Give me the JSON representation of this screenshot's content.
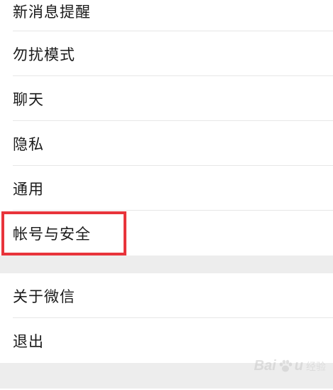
{
  "settings": {
    "items": [
      {
        "label": "新消息提醒"
      },
      {
        "label": "勿扰模式"
      },
      {
        "label": "聊天"
      },
      {
        "label": "隐私"
      },
      {
        "label": "通用"
      },
      {
        "label": "帐号与安全"
      }
    ],
    "items2": [
      {
        "label": "关于微信"
      },
      {
        "label": "退出"
      }
    ]
  },
  "highlight": {
    "target": "帐号与安全",
    "color": "#e8343b"
  },
  "watermark": {
    "brand_left": "Bai",
    "brand_right": "u",
    "sub": "经验"
  },
  "colors": {
    "background": "#ffffff",
    "section_gap": "#ededed",
    "divider": "#e7e7e7",
    "text": "#1a1a1a"
  }
}
